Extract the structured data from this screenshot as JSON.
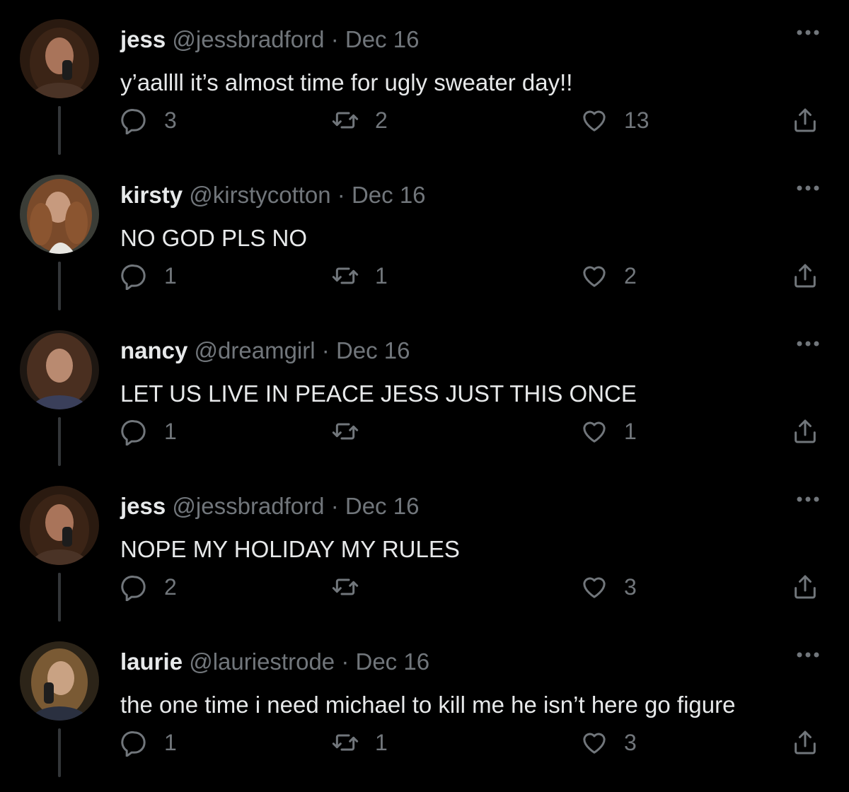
{
  "colors": {
    "background": "#000000",
    "text_primary": "#e7e9ea",
    "text_secondary": "#71767b",
    "thread_line": "#333639"
  },
  "icons": {
    "reply": "reply-icon",
    "retweet": "retweet-icon",
    "like": "heart-icon",
    "share": "share-icon",
    "more": "more-icon"
  },
  "separator": "·",
  "tweets": [
    {
      "name": "jess",
      "handle": "@jessbradford",
      "date": "Dec 16",
      "text": "y’aallll it’s almost time for ugly sweater day!!",
      "replies": "3",
      "retweets": "2",
      "likes": "13"
    },
    {
      "name": "kirsty",
      "handle": "@kirstycotton",
      "date": "Dec 16",
      "text": "NO GOD PLS NO",
      "replies": "1",
      "retweets": "1",
      "likes": "2"
    },
    {
      "name": "nancy",
      "handle": "@dreamgirl",
      "date": "Dec 16",
      "text": "LET US LIVE IN PEACE JESS JUST THIS ONCE",
      "replies": "1",
      "retweets": "",
      "likes": "1"
    },
    {
      "name": "jess",
      "handle": "@jessbradford",
      "date": "Dec 16",
      "text": "NOPE MY HOLIDAY MY RULES",
      "replies": "2",
      "retweets": "",
      "likes": "3"
    },
    {
      "name": "laurie",
      "handle": "@lauriestrode",
      "date": "Dec 16",
      "text": "the one time i need michael to kill me he isn’t here go figure",
      "replies": "1",
      "retweets": "1",
      "likes": "3"
    }
  ]
}
